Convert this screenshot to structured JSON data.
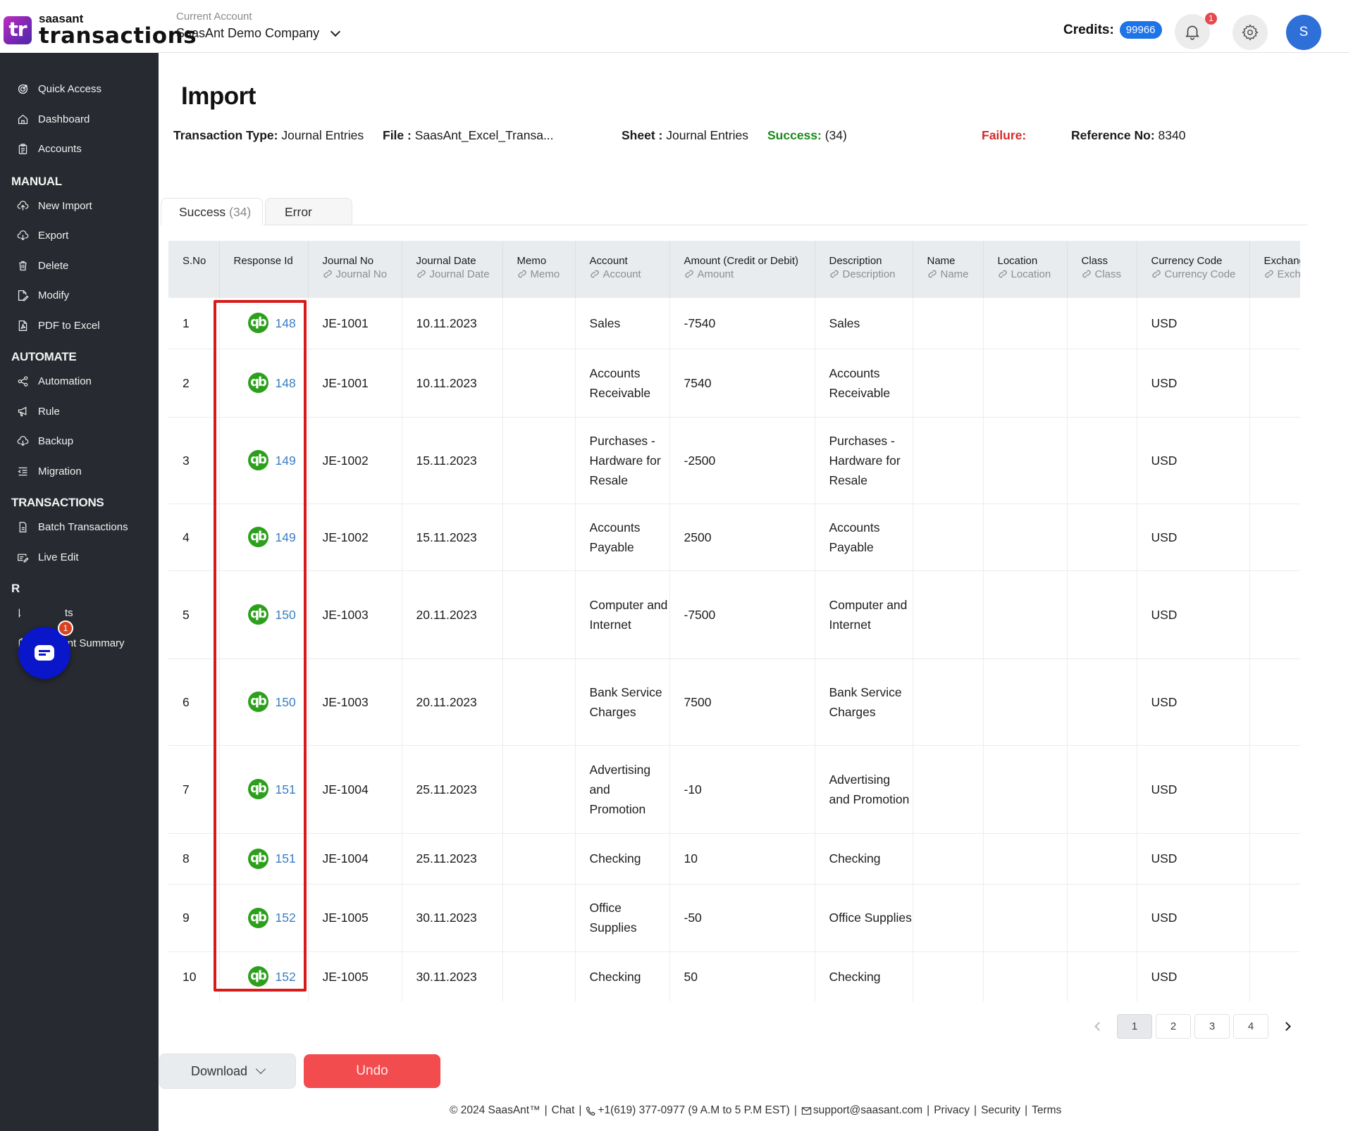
{
  "app": {
    "logo_mark": "tr",
    "logo_small": "saasant",
    "logo_big": "transactions"
  },
  "header": {
    "account_label": "Current Account",
    "account_name": "SaasAnt Demo Company",
    "credits_label": "Credits:",
    "credits_value": "99966",
    "notification_count": "1",
    "avatar_initial": "S"
  },
  "sidebar": {
    "top_items": [
      {
        "label": "Quick Access",
        "icon": "target-icon"
      },
      {
        "label": "Dashboard",
        "icon": "home-icon"
      },
      {
        "label": "Accounts",
        "icon": "clipboard-icon"
      }
    ],
    "sections": [
      {
        "title": "MANUAL",
        "items": [
          {
            "label": "New Import",
            "icon": "cloud-upload-icon"
          },
          {
            "label": "Export",
            "icon": "cloud-download-icon"
          },
          {
            "label": "Delete",
            "icon": "trash-icon"
          },
          {
            "label": "Modify",
            "icon": "edit-file-icon"
          },
          {
            "label": "PDF to Excel",
            "icon": "pdf-icon"
          }
        ]
      },
      {
        "title": "AUTOMATE",
        "items": [
          {
            "label": "Automation",
            "icon": "share-icon"
          },
          {
            "label": "Rule",
            "icon": "megaphone-icon"
          },
          {
            "label": "Backup",
            "icon": "cloud-download-icon"
          },
          {
            "label": "Migration",
            "icon": "indent-list-icon"
          }
        ]
      },
      {
        "title": "TRANSACTIONS",
        "items": [
          {
            "label": "Batch Transactions",
            "icon": "document-icon"
          },
          {
            "label": "Live Edit",
            "icon": "edit-lines-icon"
          }
        ]
      },
      {
        "title": "R",
        "items": [
          {
            "label": "ts",
            "icon": "chart-icon"
          },
          {
            "label": "Account Summary",
            "icon": "clipboard-icon"
          }
        ]
      }
    ],
    "chat_badge": "1"
  },
  "page": {
    "title": "Import",
    "meta": {
      "transaction_type_label": "Transaction Type:",
      "transaction_type_value": "Journal Entries",
      "file_label": "File :",
      "file_value": "SaasAnt_Excel_Transa...",
      "sheet_label": "Sheet :",
      "sheet_value": "Journal Entries",
      "success_label": "Success:",
      "success_value": "(34)",
      "failure_label": "Failure:",
      "failure_value": "",
      "reference_label": "Reference No:",
      "reference_value": "8340"
    },
    "tabs": [
      {
        "label": "Success",
        "count": "(34)",
        "active": true
      },
      {
        "label": "Error",
        "count": "",
        "active": false
      }
    ]
  },
  "table": {
    "columns": [
      {
        "title": "S.No",
        "sub": ""
      },
      {
        "title": "Response Id",
        "sub": ""
      },
      {
        "title": "Journal No",
        "sub": "Journal No"
      },
      {
        "title": "Journal Date",
        "sub": "Journal Date"
      },
      {
        "title": "Memo",
        "sub": "Memo"
      },
      {
        "title": "Account",
        "sub": "Account"
      },
      {
        "title": "Amount (Credit or Debit)",
        "sub": "Amount"
      },
      {
        "title": "Description",
        "sub": "Description"
      },
      {
        "title": "Name",
        "sub": "Name"
      },
      {
        "title": "Location",
        "sub": "Location"
      },
      {
        "title": "Class",
        "sub": "Class"
      },
      {
        "title": "Currency Code",
        "sub": "Currency Code"
      },
      {
        "title": "Exchange",
        "sub": "Exchange Rate"
      }
    ],
    "rows": [
      {
        "sno": "1",
        "response_id": "148",
        "journal_no": "JE-1001",
        "journal_date": "10.11.2023",
        "memo": "",
        "account": "Sales",
        "amount": "-7540",
        "description": "Sales",
        "name": "",
        "location": "",
        "class": "",
        "currency": "USD",
        "exchange": ""
      },
      {
        "sno": "2",
        "response_id": "148",
        "journal_no": "JE-1001",
        "journal_date": "10.11.2023",
        "memo": "",
        "account": "Accounts Receivable",
        "amount": "7540",
        "description": "Accounts Receivable",
        "name": "",
        "location": "",
        "class": "",
        "currency": "USD",
        "exchange": ""
      },
      {
        "sno": "3",
        "response_id": "149",
        "journal_no": "JE-1002",
        "journal_date": "15.11.2023",
        "memo": "",
        "account": "Purchases - Hardware for Resale",
        "amount": "-2500",
        "description": "Purchases - Hardware for Resale",
        "name": "",
        "location": "",
        "class": "",
        "currency": "USD",
        "exchange": ""
      },
      {
        "sno": "4",
        "response_id": "149",
        "journal_no": "JE-1002",
        "journal_date": "15.11.2023",
        "memo": "",
        "account": "Accounts Payable",
        "amount": "2500",
        "description": "Accounts Payable",
        "name": "",
        "location": "",
        "class": "",
        "currency": "USD",
        "exchange": ""
      },
      {
        "sno": "5",
        "response_id": "150",
        "journal_no": "JE-1003",
        "journal_date": "20.11.2023",
        "memo": "",
        "account": "Computer and Internet",
        "amount": "-7500",
        "description": "Computer and Internet",
        "name": "",
        "location": "",
        "class": "",
        "currency": "USD",
        "exchange": ""
      },
      {
        "sno": "6",
        "response_id": "150",
        "journal_no": "JE-1003",
        "journal_date": "20.11.2023",
        "memo": "",
        "account": "Bank Service Charges",
        "amount": "7500",
        "description": "Bank Service Charges",
        "name": "",
        "location": "",
        "class": "",
        "currency": "USD",
        "exchange": ""
      },
      {
        "sno": "7",
        "response_id": "151",
        "journal_no": "JE-1004",
        "journal_date": "25.11.2023",
        "memo": "",
        "account": "Advertising and Promotion",
        "amount": "-10",
        "description": "Advertising and Promotion",
        "name": "",
        "location": "",
        "class": "",
        "currency": "USD",
        "exchange": ""
      },
      {
        "sno": "8",
        "response_id": "151",
        "journal_no": "JE-1004",
        "journal_date": "25.11.2023",
        "memo": "",
        "account": "Checking",
        "amount": "10",
        "description": "Checking",
        "name": "",
        "location": "",
        "class": "",
        "currency": "USD",
        "exchange": ""
      },
      {
        "sno": "9",
        "response_id": "152",
        "journal_no": "JE-1005",
        "journal_date": "30.11.2023",
        "memo": "",
        "account": "Office Supplies",
        "amount": "-50",
        "description": "Office Supplies",
        "name": "",
        "location": "",
        "class": "",
        "currency": "USD",
        "exchange": ""
      },
      {
        "sno": "10",
        "response_id": "152",
        "journal_no": "JE-1005",
        "journal_date": "30.11.2023",
        "memo": "",
        "account": "Checking",
        "amount": "50",
        "description": "Checking",
        "name": "",
        "location": "",
        "class": "",
        "currency": "USD",
        "exchange": ""
      }
    ]
  },
  "pagination": {
    "pages": [
      "1",
      "2",
      "3",
      "4"
    ],
    "current": "1"
  },
  "actions": {
    "download_label": "Download",
    "undo_label": "Undo"
  },
  "footer": {
    "copyright": "© 2024 SaasAnt™",
    "chat": "Chat",
    "phone": "+1(619) 377-0977 (9 A.M to 5 P.M EST)",
    "email": "support@saasant.com",
    "privacy": "Privacy",
    "security": "Security",
    "terms": "Terms"
  },
  "colors": {
    "sidebar_bg": "#272a30",
    "accent_blue": "#1d73e8",
    "success_green": "#1a8a1a",
    "failure_red": "#d42a2a",
    "undo_red": "#f24c4f",
    "qb_green": "#2ca01c",
    "highlight_red": "#d71a1a"
  }
}
